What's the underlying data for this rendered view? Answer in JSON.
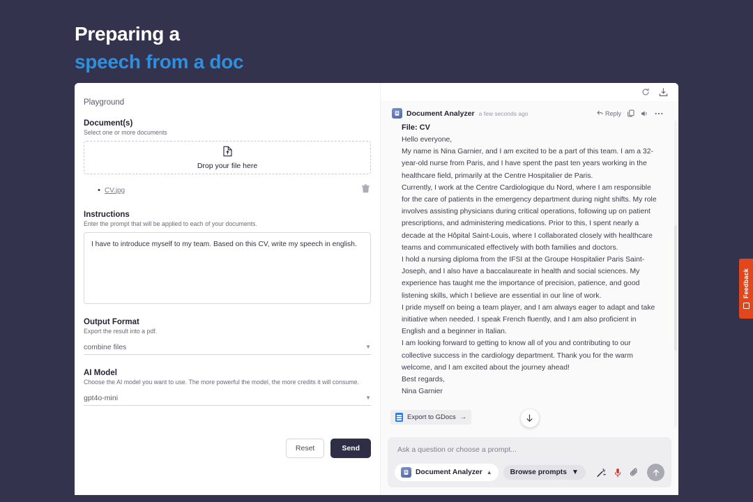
{
  "slide": {
    "title_line1": "Preparing a",
    "title_line2": "speech from a doc",
    "accent_color": "#2e8fe0",
    "background_color": "#33334d"
  },
  "app": {
    "header": {
      "breadcrumb": "Playground",
      "refresh_icon": "refresh-icon",
      "download_icon": "download-icon"
    },
    "form": {
      "documents": {
        "title": "Document(s)",
        "hint": "Select one or more documents",
        "dropzone_text": "Drop your file here",
        "dropzone_icon": "file-upload-icon",
        "files": [
          {
            "name": "CV.jpg",
            "delete_icon": "trash-icon"
          }
        ]
      },
      "instructions": {
        "title": "Instructions",
        "hint": "Enter the prompt that will be applied to each of your documents.",
        "value": "I have to introduce myself to my team. Based on this CV, write my speech in english.",
        "placeholder": ""
      },
      "output_format": {
        "title": "Output Format",
        "hint": "Export the result into a pdf.",
        "selected": "combine files"
      },
      "ai_model": {
        "title": "AI Model",
        "hint": "Choose the AI model you want to use. The more powerful the model, the more credits it will consume.",
        "selected": "gpt4o-mini"
      },
      "actions": {
        "reset_label": "Reset",
        "send_label": "Send"
      }
    },
    "chat": {
      "message": {
        "author": "Document Analyzer",
        "timestamp": "a few seconds ago",
        "avatar_icon": "document-analyzer-avatar",
        "file_label": "File: CV",
        "actions": {
          "reply_label": "Reply",
          "reply_icon": "reply-arrow-icon",
          "copy_icon": "copy-icon",
          "speak_icon": "speaker-icon",
          "more_icon": "ellipsis-icon"
        },
        "paragraphs": [
          "Hello everyone,",
          "My name is Nina Garnier, and I am excited to be a part of this team. I am a 32-year-old nurse from Paris, and I have spent the past ten years working in the healthcare field, primarily at the Centre Hospitalier de Paris.",
          "Currently, I work at the Centre Cardiologique du Nord, where I am responsible for the care of patients in the emergency department during night shifts. My role involves assisting physicians during critical operations, following up on patient prescriptions, and administering medications. Prior to this, I spent nearly a decade at the Hôpital Saint-Louis, where I collaborated closely with healthcare teams and communicated effectively with both families and doctors.",
          "I hold a nursing diploma from the IFSI at the Groupe Hospitalier Paris Saint-Joseph, and I also have a baccalaureate in health and social sciences. My experience has taught me the importance of precision, patience, and good listening skills, which I believe are essential in our line of work.",
          "I pride myself on being a team player, and I am always eager to adapt and take initiative when needed. I speak French fluently, and I am also proficient in English and a beginner in Italian.",
          "I am looking forward to getting to know all of you and contributing to our collective success in the cardiology department. Thank you for the warm welcome, and I am excited about the journey ahead!",
          "Best regards,",
          "Nina Garnier"
        ],
        "export_chip": {
          "label": "Export to GDocs",
          "arrow": "→",
          "icon": "gdocs-icon"
        }
      },
      "scroll_down_icon": "arrow-down-icon"
    },
    "composer": {
      "placeholder": "Ask a question or choose a prompt...",
      "value": "",
      "model_pill": {
        "label": "Document Analyzer",
        "chevron": "⌃",
        "icon": "document-analyzer-avatar"
      },
      "browse_pill": {
        "label": "Browse prompts",
        "chevron": "⌄"
      },
      "icons": {
        "magic_wand": "magic-wand-icon",
        "microphone": "microphone-icon",
        "attachment": "paperclip-icon",
        "send": "send-arrow-icon"
      }
    },
    "feedback": {
      "label": "Feedback",
      "icon": "feedback-icon",
      "color": "#e3461a"
    }
  }
}
